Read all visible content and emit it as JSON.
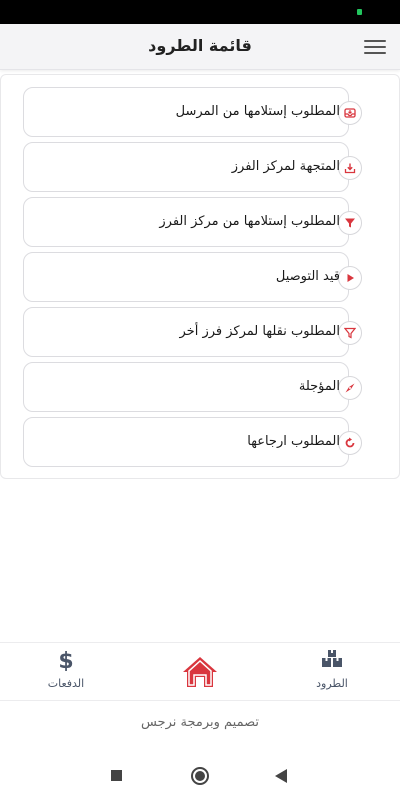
{
  "header": {
    "title": "قائمة الطرود"
  },
  "items": [
    {
      "label": "المطلوب إستلامها من المرسل",
      "icon": "inbox-tray-icon"
    },
    {
      "label": "المتجهة لمركز الفرز",
      "icon": "download-tray-icon"
    },
    {
      "label": "المطلوب إستلامها من مركز الفرز",
      "icon": "filter-funnel-icon"
    },
    {
      "label": "قيد التوصيل",
      "icon": "play-icon"
    },
    {
      "label": "المطلوب نقلها لمركز فرز أخر",
      "icon": "funnel-outline-icon"
    },
    {
      "label": "المؤجلة",
      "icon": "compass-icon"
    },
    {
      "label": "المطلوب ارجاعها",
      "icon": "return-arrow-icon"
    }
  ],
  "bottom_nav": {
    "parcels": "الطرود",
    "payments": "الدفعات"
  },
  "footer": {
    "credit": "تصميم وبرمجة نرجس"
  },
  "colors": {
    "accent": "#d9363e",
    "nav_icon": "#4a5568"
  }
}
